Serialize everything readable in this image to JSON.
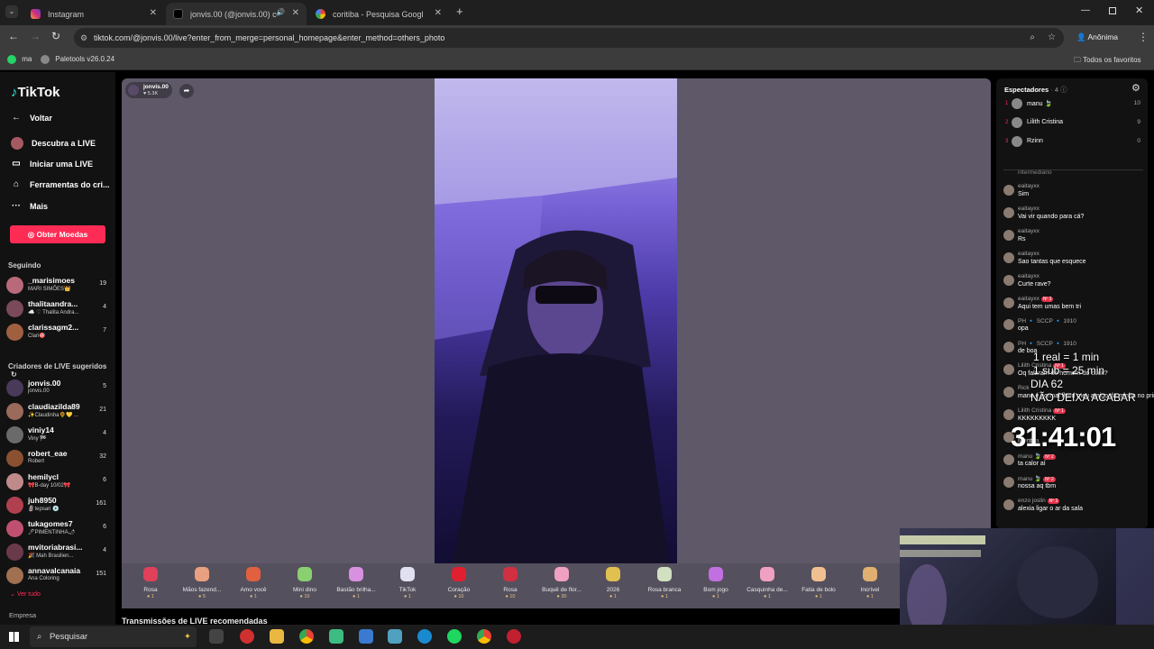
{
  "browser": {
    "tabs": [
      {
        "title": "Instagram",
        "active": false
      },
      {
        "title": "jonvis.00 (@jonvis.00) comc",
        "active": false
      },
      {
        "title": "coritiba - Pesquisa Google",
        "active": true
      }
    ],
    "url": "tiktok.com/@jonvis.00/live?enter_from_merge=personal_homepage&enter_method=others_photo",
    "profile_label": "Anônima",
    "bookmarks": [
      "ma",
      "Paletools v26.0.24"
    ],
    "all_favorites": "Todos os favoritos"
  },
  "sidebar": {
    "logo": "TikTok",
    "back": "Voltar",
    "nav": [
      "Descubra a LIVE",
      "Iniciar uma LIVE",
      "Ferramentas do cri...",
      "Mais"
    ],
    "coins_button": "Obter Moedas",
    "following_title": "Seguindo",
    "following": [
      {
        "name": "_marisimoes",
        "sub": "MARI SIMÕES👑",
        "count": "19",
        "color": "#b86a7a"
      },
      {
        "name": "thalitaandra...",
        "sub": "☁️ ♡ Thalita Andra...",
        "count": "4",
        "color": "#7a4a5a"
      },
      {
        "name": "clarissagm2...",
        "sub": "Clari🎯",
        "count": "7",
        "color": "#a06040"
      }
    ],
    "suggested_title": "Criadores de LIVE sugeridos",
    "suggested": [
      {
        "name": "jonvis.00",
        "sub": "jonvis.00",
        "count": "5",
        "color": "#4a3a5a"
      },
      {
        "name": "claudiazilda89",
        "sub": "✨Claudinha🌻💛 ...",
        "count": "21",
        "color": "#9a6a5a"
      },
      {
        "name": "viniy14",
        "sub": "Viny 🏁",
        "count": "4",
        "color": "#6a6a6a"
      },
      {
        "name": "robert_eae",
        "sub": "Robert",
        "count": "32",
        "color": "#8a5030"
      },
      {
        "name": "hemilycl",
        "sub": "🎀B-day 10/02🎀",
        "count": "6",
        "color": "#c08a8a"
      },
      {
        "name": "juh8950",
        "sub": "🗿tepsari 💿",
        "count": "161",
        "color": "#b04050"
      },
      {
        "name": "tukagomes7",
        "sub": "🖊PIMENTINHA🌶",
        "count": "6",
        "color": "#c05070"
      },
      {
        "name": "mvitoriabrasi...",
        "sub": "🎉 Mah Brasilien...",
        "count": "4",
        "color": "#6a3a4a"
      },
      {
        "name": "annavalcanaia",
        "sub": "Ana Coloring",
        "count": "151",
        "color": "#a07050"
      }
    ],
    "see_all": "Ver tudo",
    "company": "Empresa"
  },
  "stream": {
    "host_name": "jonvis.00",
    "host_likes": "5.3K",
    "recommended_title": "Transmissões de LIVE recomendadas"
  },
  "gifts": [
    {
      "name": "Rosa",
      "price": "1",
      "color": "#e0405a"
    },
    {
      "name": "Mãos fazend...",
      "price": "5",
      "color": "#e8a080"
    },
    {
      "name": "Amo você",
      "price": "1",
      "color": "#e06040"
    },
    {
      "name": "Mini dino",
      "price": "10",
      "color": "#8ad070"
    },
    {
      "name": "Bastão brilha...",
      "price": "1",
      "color": "#d890e0"
    },
    {
      "name": "TikTok",
      "price": "1",
      "color": "#e0e0f0"
    },
    {
      "name": "Coração",
      "price": "10",
      "color": "#e02030"
    },
    {
      "name": "Rosa",
      "price": "10",
      "color": "#d03040"
    },
    {
      "name": "Buquê de flor...",
      "price": "30",
      "color": "#f0a0c0"
    },
    {
      "name": "2026",
      "price": "1",
      "color": "#e0c050"
    },
    {
      "name": "Rosa branca",
      "price": "1",
      "color": "#d0e0c0"
    },
    {
      "name": "Bom jogo",
      "price": "1",
      "color": "#c070e0"
    },
    {
      "name": "Casquinha de...",
      "price": "1",
      "color": "#f0a0c0"
    },
    {
      "name": "Fatia de bolo",
      "price": "1",
      "color": "#f0c090"
    },
    {
      "name": "Incrível",
      "price": "1",
      "color": "#e0b070"
    }
  ],
  "viewers": {
    "title": "Espectadores",
    "count": "4",
    "list": [
      {
        "rank": "1",
        "name": "manu 🍃",
        "score": "10"
      },
      {
        "rank": "2",
        "name": "Lilith Cristina",
        "score": "9"
      },
      {
        "rank": "3",
        "name": "Rzinn",
        "score": "0"
      }
    ]
  },
  "chat": {
    "divider": "intermediário",
    "messages": [
      {
        "user": "eaitayxx",
        "badge": "",
        "text": "Sim"
      },
      {
        "user": "eaitayxx",
        "badge": "",
        "text": "Vai vir quando para cá?"
      },
      {
        "user": "eaitayxx",
        "badge": "",
        "text": "Rs"
      },
      {
        "user": "eaitayxx",
        "badge": "",
        "text": "Sao tantas que esquece"
      },
      {
        "user": "eaitayxx",
        "badge": "",
        "text": "Curte rave?"
      },
      {
        "user": "eaitayxx",
        "badge": "Nº 3",
        "text": "Aqui tem umas bem tri"
      },
      {
        "user": "PH 🔹 SCCP 🔹 1910",
        "badge": "",
        "text": "opa"
      },
      {
        "user": "PH 🔹 SCCP 🔹 1910",
        "badge": "",
        "text": "de boa"
      },
      {
        "user": "Lilith Cristina",
        "badge": "Nº 1",
        "text": "Oq falaram do homem do cuck?"
      },
      {
        "user": "Rick",
        "badge": "",
        "text": "mano é normal flwrd meu amigo da minha no primeiro encontro"
      },
      {
        "user": "Lilith Cristina",
        "badge": "Nº 1",
        "text": "KKKKKKKKK"
      },
      {
        "user": "",
        "badge": "",
        "text": "Mentira"
      },
      {
        "user": "manu 🍃",
        "badge": "Nº 2",
        "text": "ta calor aí"
      },
      {
        "user": "manu 🍃",
        "badge": "Nº 2",
        "text": "nossa aq tbm"
      },
      {
        "user": "enzo joslin",
        "badge": "Nº 3",
        "text": "alexia ligar o ar da sala"
      }
    ]
  },
  "overlay": {
    "line1": "1 real = 1 min",
    "line2": "1 sub = 25 min",
    "line3": "DIA 62",
    "line4": "NÃO DEIXA ACABAR",
    "timer": "31:41:01"
  },
  "taskbar": {
    "search_placeholder": "Pesquisar"
  }
}
